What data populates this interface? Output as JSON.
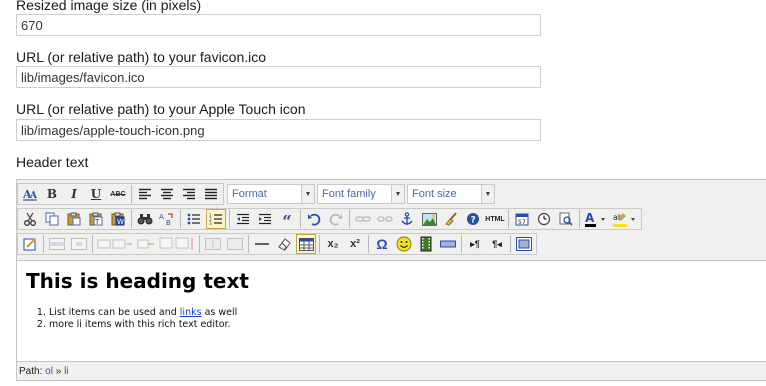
{
  "fields": [
    {
      "label": "Resized image size (in pixels)",
      "value": "670"
    },
    {
      "label": "URL (or relative path) to your favicon.ico",
      "value": "lib/images/favicon.ico"
    },
    {
      "label": "URL (or relative path) to your Apple Touch icon",
      "value": "lib/images/apple-touch-icon.png"
    }
  ],
  "header_text": {
    "label": "Header text",
    "toolbar": {
      "format_label": "Format",
      "font_family_label": "Font family",
      "font_size_label": "Font size",
      "bold": "B",
      "italic": "I",
      "underline": "U",
      "strike": "ABC",
      "html": "HTML",
      "sup": "x²",
      "sub": "x₂",
      "omega": "Ω",
      "ltr": "▸¶",
      "rtl": "¶◂",
      "quote": "“"
    },
    "editor": {
      "heading": "This is heading text",
      "list": {
        "item1_before": "List items can be used and ",
        "item1_link": "links",
        "item1_after": " as well",
        "item2": "more li items with this rich text editor."
      }
    },
    "path_bar": {
      "label": "Path:",
      "items": [
        "ol",
        "li"
      ],
      "separator": "»"
    }
  }
}
